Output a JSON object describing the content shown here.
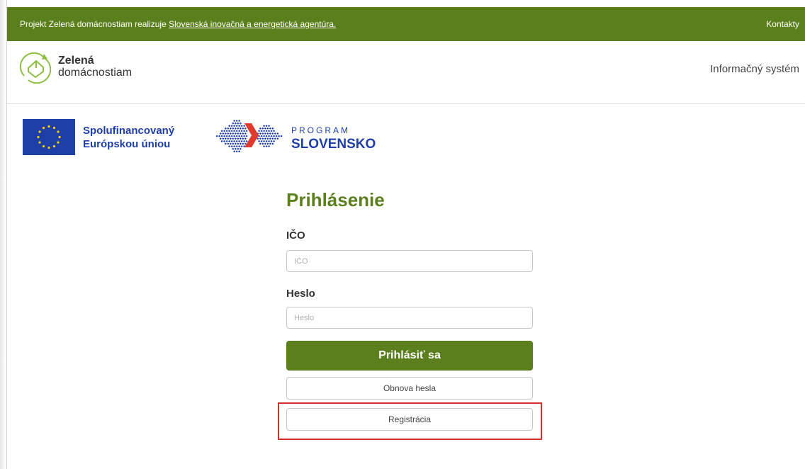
{
  "topbar": {
    "message_prefix": "Projekt Zelená domácnostiam realizuje ",
    "agency_link": "Slovenská inovačná a energetická agentúra.",
    "contacts_link": "Kontakty"
  },
  "header": {
    "brand_line1": "Zelená",
    "brand_line2": "domácnostiam",
    "system_name": "Informačný systém"
  },
  "funding": {
    "eu_line1": "Spolufinancovaný",
    "eu_line2": "Európskou úniou",
    "program_line1": "PROGRAM",
    "program_line2": "SLOVENSKO"
  },
  "login": {
    "title": "Prihlásenie",
    "ico_label": "IČO",
    "ico_placeholder": "IČO",
    "ico_value": "",
    "password_label": "Heslo",
    "password_placeholder": "Heslo",
    "password_value": "",
    "submit_label": "Prihlásiť sa",
    "reset_label": "Obnova hesla",
    "register_label": "Registrácia"
  },
  "colors": {
    "brand_green": "#5a7f1c",
    "eu_blue": "#1f3fa8",
    "highlight_red": "#d32f2f",
    "program_red": "#e03a2f"
  },
  "icons": [
    "house-leaf-logo-icon",
    "eu-flag-icon",
    "program-slovensko-logo-icon"
  ]
}
